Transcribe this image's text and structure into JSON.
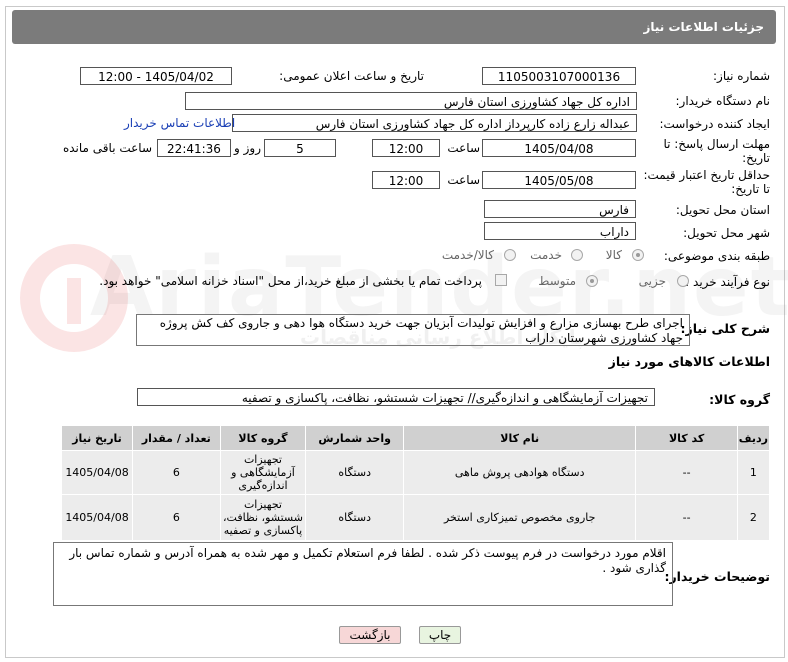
{
  "header": {
    "title": "جزئیات اطلاعات نیاز"
  },
  "watermark": {
    "text": "AriaTender.net",
    "sub": "پایگاه اطلاع رسانی مناقصات"
  },
  "fields": {
    "need_number_label": "شماره نیاز:",
    "need_number": "1105003107000136",
    "announce_label": "تاریخ و ساعت اعلان عمومی:",
    "announce_value": "1405/04/02 - 12:00",
    "buyer_org_label": "نام دستگاه خریدار:",
    "buyer_org": "اداره کل جهاد کشاورزی استان فارس",
    "creator_label": "ایجاد کننده درخواست:",
    "creator": "عبداله زارع زاده کارپرداز اداره کل جهاد کشاورزی استان فارس",
    "contact_link": "اطلاعات تماس خریدار",
    "deadline_label": "مهلت ارسال پاسخ: تا تاریخ:",
    "deadline_date": "1405/04/08",
    "time_label": "ساعت",
    "deadline_time": "12:00",
    "days": "5",
    "days_label": "روز و",
    "remaining_time": "22:41:36",
    "remaining_label": "ساعت باقی مانده",
    "validity_label": "حداقل تاریخ اعتبار قیمت: تا تاریخ:",
    "validity_date": "1405/05/08",
    "validity_time": "12:00",
    "province_label": "استان محل تحویل:",
    "province": "فارس",
    "city_label": "شهر محل تحویل:",
    "city": "داراب",
    "category_label": "طبقه بندی موضوعی:",
    "category_options": [
      "کالا",
      "خدمت",
      "کالا/خدمت"
    ],
    "process_label": "نوع فرآیند خرید :",
    "process_options": [
      "جزیی",
      "متوسط"
    ],
    "payment_note": "پرداخت تمام یا بخشی از مبلغ خرید،از محل \"اسناد خزانه اسلامی\" خواهد بود."
  },
  "description": {
    "label": "شرح کلی نیاز:",
    "text": "اجرای طرح بهسازی مزارع و افزایش تولیدات آبزیان  جهت خرید دستگاه هوا دهی و جاروی کف کش    پروژه جهاد کشاورزی شهرستان داراب"
  },
  "goods": {
    "section_title": "اطلاعات کالاهای مورد نیاز",
    "group_label": "گروه کالا:",
    "group_value": "تجهیزات آزمایشگاهی و اندازه‌گیری// تجهیزات شستشو، نظافت، پاکسازی و تصفیه",
    "columns": [
      "ردیف",
      "کد کالا",
      "نام کالا",
      "واحد شمارش",
      "گروه کالا",
      "تعداد / مقدار",
      "تاریخ نیاز"
    ],
    "rows": [
      {
        "row": "1",
        "code": "--",
        "name": "دستگاه هوادهی پروش ماهی",
        "unit": "دستگاه",
        "group": "تجهیزات آزمایشگاهی و اندازه‌گیری",
        "qty": "6",
        "date": "1405/04/08"
      },
      {
        "row": "2",
        "code": "--",
        "name": "جاروی مخصوص تمیزکاری استخر",
        "unit": "دستگاه",
        "group": "تجهیزات شستشو، نظافت، پاکسازی و تصفیه",
        "qty": "6",
        "date": "1405/04/08"
      }
    ]
  },
  "buyer_notes": {
    "label": "توضیحات خریدار:",
    "text": "اقلام مورد درخواست در فرم پیوست ذکر شده . لطفا فرم استعلام  تکمیل و مهر شده به همراه آدرس و شماره تماس بار گذاری شود ."
  },
  "buttons": {
    "print": "چاپ",
    "back": "بازگشت"
  },
  "colors": {
    "header_bg": "#7b7b7b",
    "link": "#1a3fb5",
    "back_button_bg": "#f7d7d7",
    "print_button_bg": "#e8f4e0"
  }
}
